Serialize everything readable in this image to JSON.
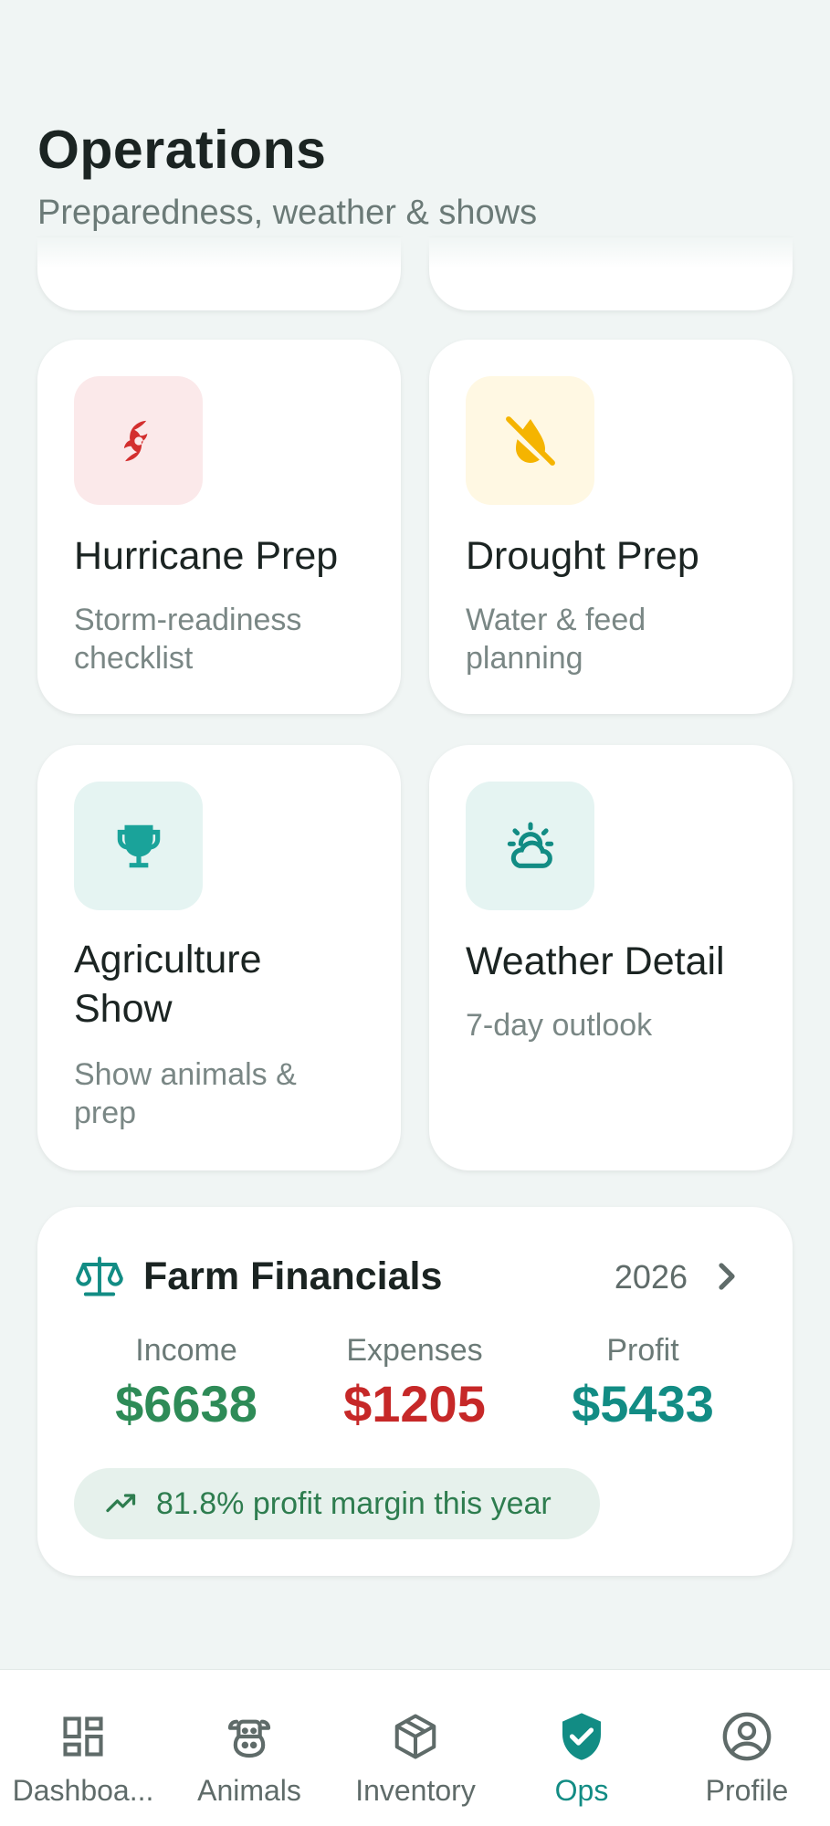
{
  "header": {
    "title": "Operations",
    "subtitle": "Preparedness, weather & shows"
  },
  "tiles": [
    {
      "title": "Hurricane Prep",
      "subtitle": "Storm-readiness checklist",
      "icon": "hurricane-icon",
      "icon_color": "#d32f2f",
      "icon_bg": "#fbe9ea"
    },
    {
      "title": "Drought Prep",
      "subtitle": "Water & feed planning",
      "icon": "no-water-drop-icon",
      "icon_color": "#f5b400",
      "icon_bg": "#fff8e3"
    },
    {
      "title": "Agriculture Show",
      "subtitle": "Show animals & prep",
      "icon": "trophy-icon",
      "icon_color": "#1aa39a",
      "icon_bg": "#e5f4f2"
    },
    {
      "title": "Weather Detail",
      "subtitle": "7-day outlook",
      "icon": "partly-cloudy-icon",
      "icon_color": "#128c84",
      "icon_bg": "#e5f4f2"
    }
  ],
  "financials": {
    "title": "Farm Financials",
    "year": "2026",
    "income_label": "Income",
    "income_value": "$6638",
    "expenses_label": "Expenses",
    "expenses_value": "$1205",
    "profit_label": "Profit",
    "profit_value": "$5433",
    "margin_text": "81.8% profit margin this year",
    "colors": {
      "income": "#2e8b57",
      "expenses": "#c62828",
      "profit": "#128c84"
    }
  },
  "nav": {
    "items": [
      {
        "label": "Dashboa...",
        "icon": "dashboard-icon",
        "active": false
      },
      {
        "label": "Animals",
        "icon": "cow-icon",
        "active": false
      },
      {
        "label": "Inventory",
        "icon": "box-icon",
        "active": false
      },
      {
        "label": "Ops",
        "icon": "shield-check-icon",
        "active": true
      },
      {
        "label": "Profile",
        "icon": "account-circle-icon",
        "active": false
      }
    ],
    "active_color": "#128c84"
  }
}
